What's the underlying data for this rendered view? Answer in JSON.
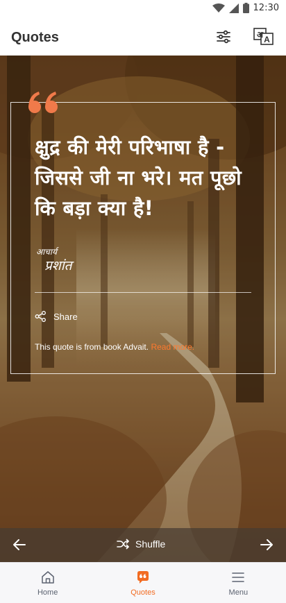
{
  "status_bar": {
    "time": "12:30"
  },
  "app_bar": {
    "title": "Quotes",
    "filter_icon": "sliders-icon",
    "language_icon": "translate-icon"
  },
  "quote": {
    "text": "क्षुद्र की मेरी परिभाषा है - जिससे जी ना भरे। मत पूछो कि बड़ा क्या है!",
    "signature_logo_text": "आचार्य प्रशांत",
    "share_label": "Share",
    "book_prefix": "This quote is from book Advait.",
    "read_more_label": "Read more."
  },
  "navigation_strip": {
    "shuffle_label": "Shuffle",
    "prev_icon": "arrow-left-icon",
    "next_icon": "arrow-right-icon"
  },
  "bottom_nav": {
    "items": [
      {
        "label": "Home",
        "icon": "home-icon",
        "active": false
      },
      {
        "label": "Quotes",
        "icon": "quote-bubble-icon",
        "active": true
      },
      {
        "label": "Menu",
        "icon": "hamburger-icon",
        "active": false
      }
    ]
  },
  "colors": {
    "accent": "#f26b21",
    "quote_mark": "#f07a4a",
    "link": "#ff7a2e"
  }
}
